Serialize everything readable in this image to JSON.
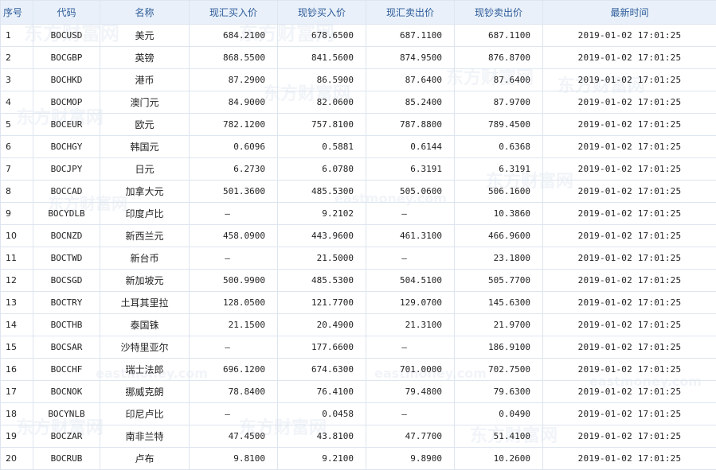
{
  "headers": [
    "序号",
    "代码",
    "名称",
    "现汇买入价",
    "现钞买入价",
    "现汇卖出价",
    "现钞卖出价",
    "最新时间"
  ],
  "watermark": {
    "cn": "东方财富网",
    "en": "eastmoney.com"
  },
  "rows": [
    [
      "1",
      "BOCUSD",
      "美元",
      "684.2100",
      "678.6500",
      "687.1100",
      "687.1100",
      "2019-01-02 17:01:25"
    ],
    [
      "2",
      "BOCGBP",
      "英镑",
      "868.5500",
      "841.5600",
      "874.9500",
      "876.8700",
      "2019-01-02 17:01:25"
    ],
    [
      "3",
      "BOCHKD",
      "港币",
      "87.2900",
      "86.5900",
      "87.6400",
      "87.6400",
      "2019-01-02 17:01:25"
    ],
    [
      "4",
      "BOCMOP",
      "澳门元",
      "84.9000",
      "82.0600",
      "85.2400",
      "87.9700",
      "2019-01-02 17:01:25"
    ],
    [
      "5",
      "BOCEUR",
      "欧元",
      "782.1200",
      "757.8100",
      "787.8800",
      "789.4500",
      "2019-01-02 17:01:25"
    ],
    [
      "6",
      "BOCHGY",
      "韩国元",
      "0.6096",
      "0.5881",
      "0.6144",
      "0.6368",
      "2019-01-02 17:01:25"
    ],
    [
      "7",
      "BOCJPY",
      "日元",
      "6.2730",
      "6.0780",
      "6.3191",
      "6.3191",
      "2019-01-02 17:01:25"
    ],
    [
      "8",
      "BOCCAD",
      "加拿大元",
      "501.3600",
      "485.5300",
      "505.0600",
      "506.1600",
      "2019-01-02 17:01:25"
    ],
    [
      "9",
      "BOCYDLB",
      "印度卢比",
      "–",
      "9.2102",
      "–",
      "10.3860",
      "2019-01-02 17:01:25"
    ],
    [
      "10",
      "BOCNZD",
      "新西兰元",
      "458.0900",
      "443.9600",
      "461.3100",
      "466.9600",
      "2019-01-02 17:01:25"
    ],
    [
      "11",
      "BOCTWD",
      "新台币",
      "–",
      "21.5000",
      "–",
      "23.1800",
      "2019-01-02 17:01:25"
    ],
    [
      "12",
      "BOCSGD",
      "新加坡元",
      "500.9900",
      "485.5300",
      "504.5100",
      "505.7700",
      "2019-01-02 17:01:25"
    ],
    [
      "13",
      "BOCTRY",
      "土耳其里拉",
      "128.0500",
      "121.7700",
      "129.0700",
      "145.6300",
      "2019-01-02 17:01:25"
    ],
    [
      "14",
      "BOCTHB",
      "泰国铢",
      "21.1500",
      "20.4900",
      "21.3100",
      "21.9700",
      "2019-01-02 17:01:25"
    ],
    [
      "15",
      "BOCSAR",
      "沙特里亚尔",
      "–",
      "177.6600",
      "–",
      "186.9100",
      "2019-01-02 17:01:25"
    ],
    [
      "16",
      "BOCCHF",
      "瑞士法郎",
      "696.1200",
      "674.6300",
      "701.0000",
      "702.7500",
      "2019-01-02 17:01:25"
    ],
    [
      "17",
      "BOCNOK",
      "挪威克朗",
      "78.8400",
      "76.4100",
      "79.4800",
      "79.6300",
      "2019-01-02 17:01:25"
    ],
    [
      "18",
      "BOCYNLB",
      "印尼卢比",
      "–",
      "0.0458",
      "–",
      "0.0490",
      "2019-01-02 17:01:25"
    ],
    [
      "19",
      "BOCZAR",
      "南非兰特",
      "47.4500",
      "43.8100",
      "47.7700",
      "51.4100",
      "2019-01-02 17:01:25"
    ],
    [
      "20",
      "BOCRUB",
      "卢布",
      "9.8100",
      "9.2100",
      "9.8900",
      "10.2600",
      "2019-01-02 17:01:25"
    ]
  ]
}
